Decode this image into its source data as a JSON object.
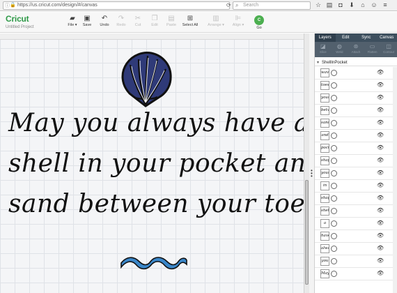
{
  "browser": {
    "url": "https://us.cricut.com/design/#/canvas",
    "search_placeholder": "Search",
    "icons": [
      "star-icon",
      "reader-icon",
      "pocket-icon",
      "download-icon",
      "home-icon",
      "emoji-icon",
      "menu-icon"
    ]
  },
  "app": {
    "logo_prefix": "Cri",
    "logo_suffix": "cut",
    "project_name": "Untitled Project",
    "toolbar": {
      "file": "File",
      "save": "Save",
      "undo": "Undo",
      "redo": "Redo",
      "cut": "Cut",
      "edit": "Edit",
      "paste": "Paste",
      "select_all": "Select All",
      "arrange": "Arrange",
      "align": "Align",
      "go": "Go"
    }
  },
  "canvas": {
    "quote_lines": [
      "May you always have a",
      "shell in your pocket and",
      "sand between your toes"
    ],
    "shell_color": "#2f3a78",
    "wave_color": "#3a86c8"
  },
  "panel": {
    "tabs": [
      "Layers",
      "Edit",
      "Sync",
      "Canvas"
    ],
    "tools": [
      "Slice",
      "Weld",
      "Attach",
      "Flatten",
      "Contour"
    ],
    "group_name": "ShellInPocket",
    "layers": [
      "wave",
      "toes",
      "your",
      "between",
      "sand",
      "and",
      "pocket",
      "shape",
      "your",
      "in",
      "shape",
      "shell",
      "a",
      "have",
      "always",
      "you",
      "May"
    ]
  }
}
